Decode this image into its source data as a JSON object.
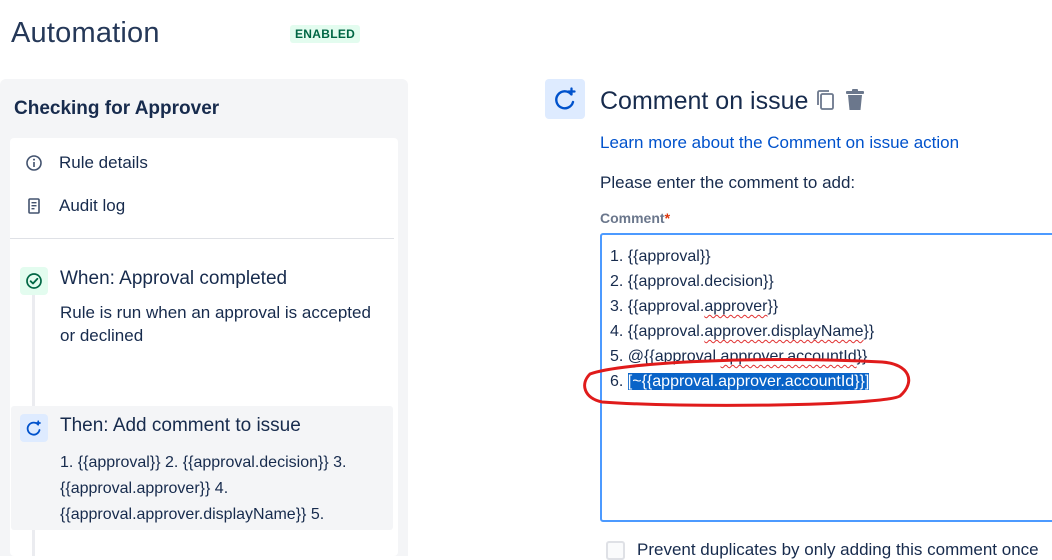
{
  "header": {
    "title": "Automation",
    "status_badge": "ENABLED"
  },
  "sidebar": {
    "rule_name": "Checking for Approver",
    "nav": [
      {
        "label": "Rule details",
        "icon": "info-icon"
      },
      {
        "label": "Audit log",
        "icon": "document-icon"
      }
    ],
    "trigger": {
      "title": "When: Approval completed",
      "description": "Rule is run when an approval is accepted or declined",
      "icon": "check-circle-icon"
    },
    "action": {
      "title": "Then: Add comment to issue",
      "description": "1. {{approval}} 2. {{approval.decision}} 3. {{approval.approver}} 4. {{approval.approver.displayName}} 5.",
      "icon": "comment-action-icon"
    }
  },
  "component": {
    "title": "Comment on issue",
    "learn_more": "Learn more about the Comment on issue action",
    "prompt": "Please enter the comment to add:",
    "field_label": "Comment",
    "required_marker": "*",
    "lines": [
      {
        "num": "1. ",
        "pre": "{{approval}}",
        "sq": "",
        "post": ""
      },
      {
        "num": "2. ",
        "pre": "{{approval.decision}}",
        "sq": "",
        "post": ""
      },
      {
        "num": "3. ",
        "pre": "{{approval.",
        "sq": "approver",
        "post": "}}"
      },
      {
        "num": "4. ",
        "pre": "{{approval.",
        "sq": "approver.displayName",
        "post": "}}"
      },
      {
        "num": "5. ",
        "pre": "@{{approval.",
        "sq": "approver.accountId",
        "post": "}}"
      },
      {
        "num": "6. ",
        "pre": "[~{{approval.",
        "sq": "approver.accountId",
        "post": "}}]"
      }
    ],
    "checkbox_label": "Prevent duplicates by only adding this comment once"
  },
  "colors": {
    "accent": "#0052cc",
    "badge_bg": "#e3fcef",
    "badge_text": "#006644",
    "selection": "#0a64c8",
    "annotation": "#e01b1b"
  }
}
